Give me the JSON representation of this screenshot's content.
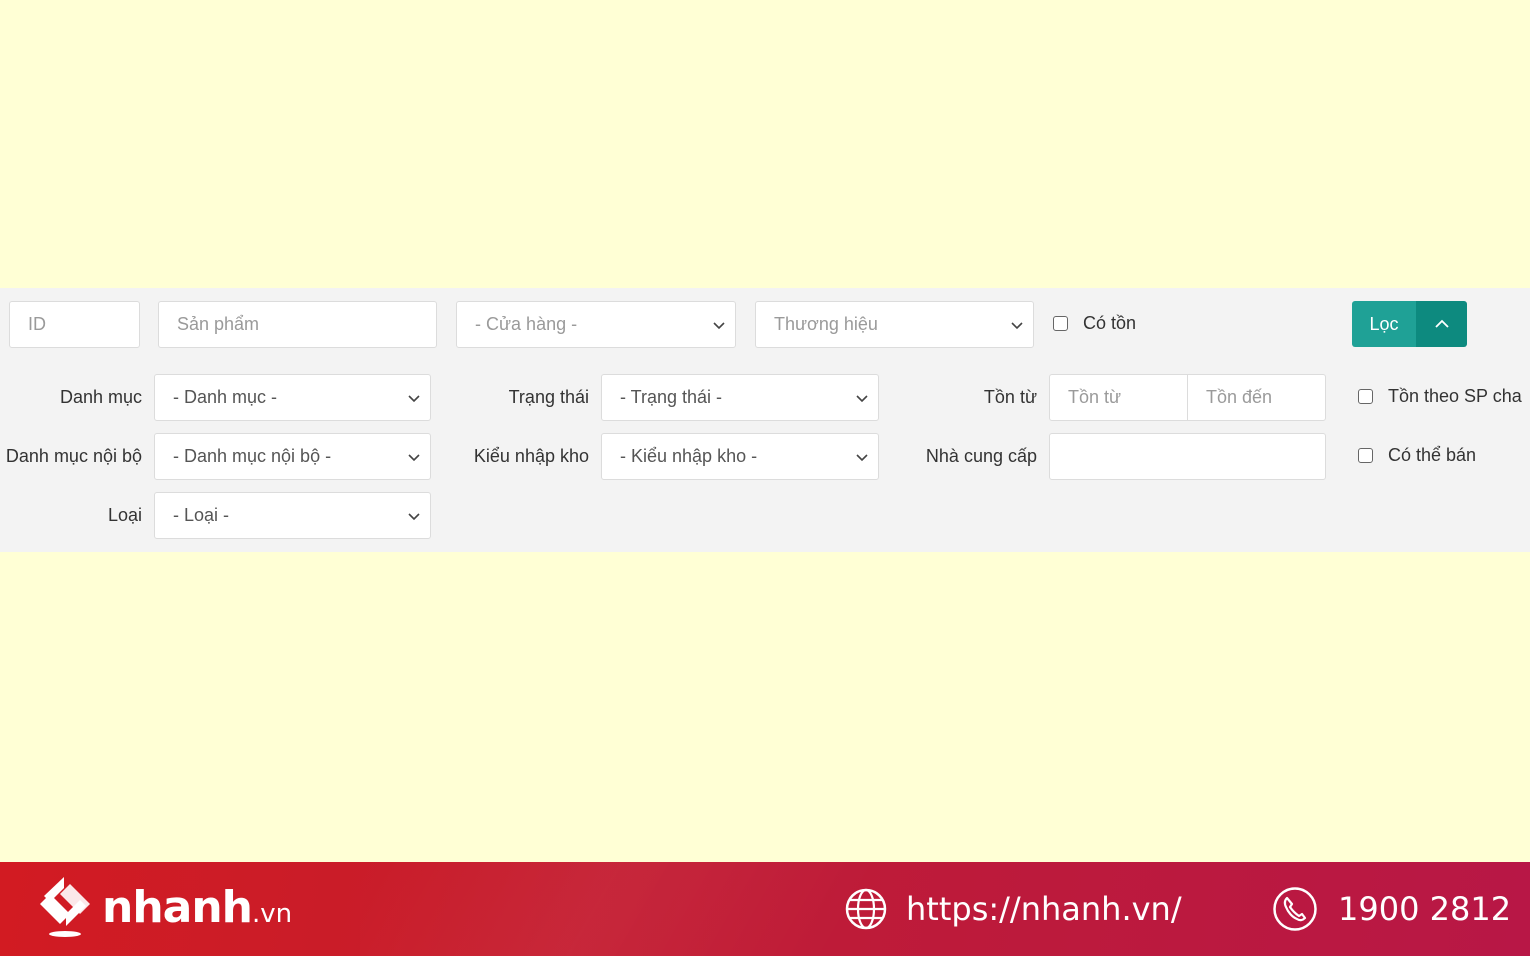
{
  "filters": {
    "id_placeholder": "ID",
    "product_placeholder": "Sản phẩm",
    "store_select": "- Cửa hàng -",
    "brand_select": "Thương hiệu",
    "in_stock_label": "Có tồn",
    "filter_button": "Lọc",
    "category_label": "Danh mục",
    "category_select": "- Danh mục -",
    "internal_category_label": "Danh mục nội bộ",
    "internal_category_select": "- Danh mục nội bộ -",
    "type_label": "Loại",
    "type_select": "- Loại -",
    "status_label": "Trạng thái",
    "status_select": "- Trạng thái -",
    "import_type_label": "Kiểu nhập kho",
    "import_type_select": "- Kiểu nhập kho -",
    "stock_range_label": "Tồn từ",
    "stock_from_placeholder": "Tồn từ",
    "stock_to_placeholder": "Tồn đến",
    "supplier_label": "Nhà cung cấp",
    "supplier_value": "",
    "stock_by_parent_label": "Tồn theo SP cha",
    "sellable_label": "Có thể bán"
  },
  "footer": {
    "brand": "nhanh",
    "brand_tld": ".vn",
    "url": "https://nhanh.vn/",
    "phone": "1900 2812"
  },
  "colors": {
    "background": "#ffffd5",
    "panel": "#f3f3f3",
    "button_primary": "#1fa196",
    "button_secondary": "#0d8a7f",
    "footer": "#c81c2a"
  }
}
